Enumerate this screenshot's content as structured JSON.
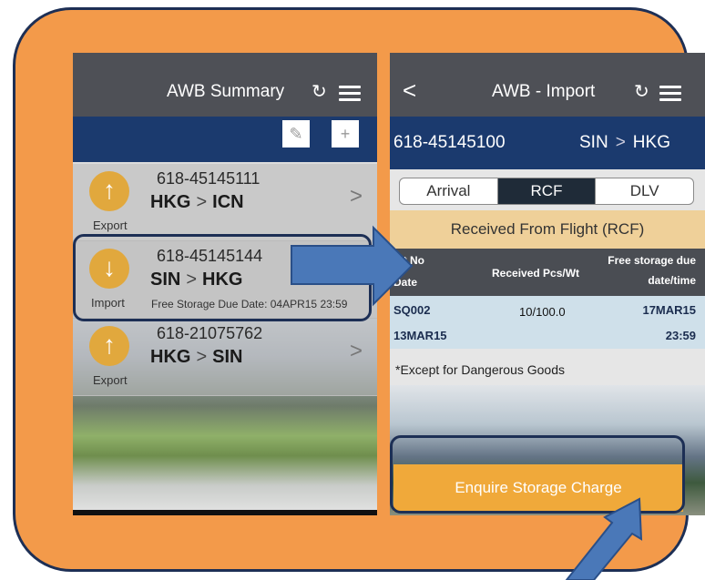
{
  "left": {
    "title": "AWB Summary",
    "refresh_glyph": "↻",
    "edit_glyph": "✎",
    "add_glyph": "+",
    "items": [
      {
        "awb": "618-45145111",
        "origin": "HKG",
        "dest": "ICN",
        "type": "Export",
        "arrow": "↑",
        "chevron": ">"
      },
      {
        "awb": "618-45145144",
        "origin": "SIN",
        "dest": "HKG",
        "type": "Import",
        "arrow": "↓",
        "chevron": ">",
        "free_storage": "Free Storage Due Date: 04APR15 23:59"
      },
      {
        "awb": "618-21075762",
        "origin": "HKG",
        "dest": "SIN",
        "type": "Export",
        "arrow": "↑",
        "chevron": ">"
      }
    ],
    "route_sep": ">"
  },
  "right": {
    "back_glyph": "<",
    "title": "AWB - Import",
    "refresh_glyph": "↻",
    "awb": "618-45145100",
    "origin": "SIN",
    "route_sep": ">",
    "dest": "HKG",
    "tabs": [
      "Arrival",
      "RCF",
      "DLV"
    ],
    "section_title": "Received From Flight (RCF)",
    "table": {
      "col1_line1": "Flt No",
      "col1_line2": "Date",
      "col2": "Received Pcs/Wt",
      "col3_line1": "Free storage due",
      "col3_line2": "date/time",
      "row_flight": "SQ002",
      "row_pcs": "10/100.0",
      "row_due_date": "17MAR15",
      "row_date": "13MAR15",
      "row_due_time": "23:59"
    },
    "note": "*Except for Dangerous Goods",
    "enquire_label": "Enquire Storage Charge"
  },
  "colors": {
    "frame_orange": "#f39a4a",
    "frame_border": "#1d2f55",
    "nav_blue": "#1b3a6e",
    "accent_gold": "#f0a93a",
    "arrow_blue": "#4a78b8"
  }
}
